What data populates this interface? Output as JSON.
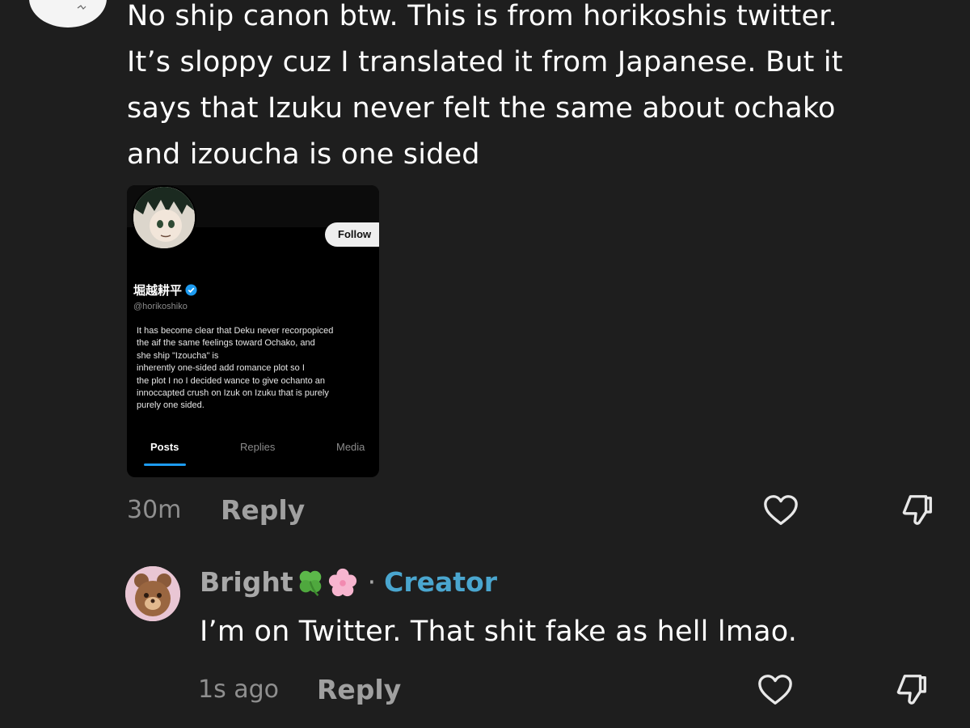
{
  "comment": {
    "lines": [
      "No ship canon btw. This is from horikoshis twitter.",
      "It’s sloppy cuz I translated it from Japanese. But it",
      "says that Izuku never felt the same about ochako",
      "and izoucha is one sided"
    ],
    "time": "30m",
    "reply_label": "Reply"
  },
  "embedded_screenshot": {
    "follow_label": "Follow",
    "display_name": "堀越耕平",
    "handle": "@horikoshiko",
    "bio_lines": [
      "It has become clear that Deku never recorpopiced",
      "the aif the same feelings toward Ochako, and",
      "she ship \"Izoucha\" is",
      "inherently one-sided add romance plot so I",
      "the plot I no I decided wance to give ochanto an",
      "innoccapted crush on Izuk on Izuku that is purely",
      "purely one sided."
    ],
    "tabs": [
      "Posts",
      "Replies",
      "Media"
    ],
    "active_tab": "Posts"
  },
  "reply_comment": {
    "author": "Bright",
    "author_emojis": [
      "four-leaf-clover-icon",
      "cherry-blossom-icon"
    ],
    "separator": "·",
    "badge": "Creator",
    "text": "I’m on Twitter. That shit fake as hell lmao.",
    "time": "1s ago",
    "reply_label": "Reply"
  },
  "colors": {
    "background": "#1e1e1e",
    "creator_badge": "#4aa6cf",
    "verified": "#1d9bf0"
  }
}
